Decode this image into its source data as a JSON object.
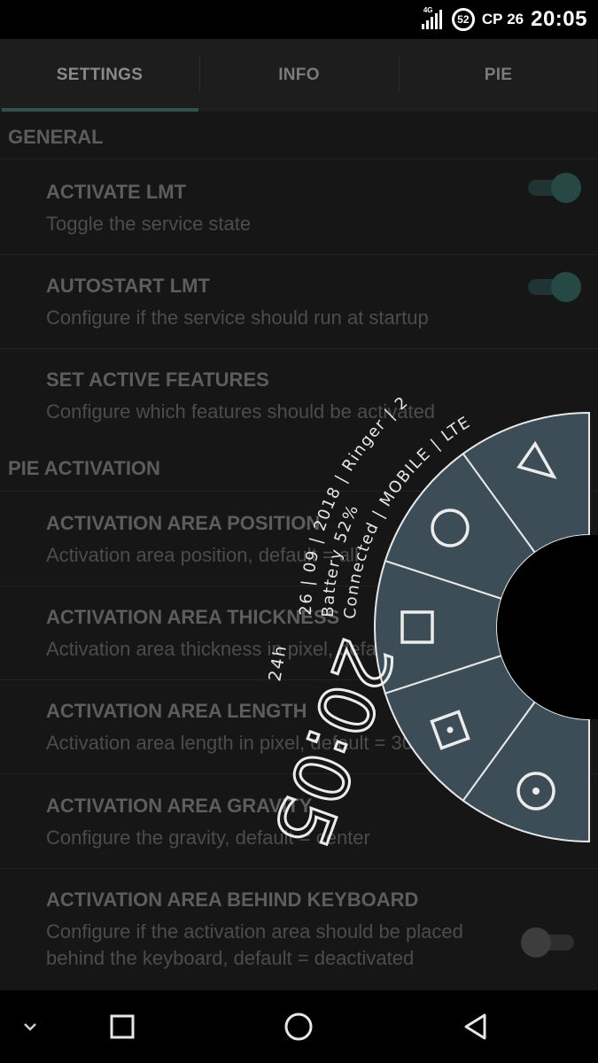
{
  "status_bar": {
    "network_type": "4G",
    "battery_level": "52",
    "date": "СР 26",
    "time": "20:05"
  },
  "tabs": [
    {
      "label": "SETTINGS",
      "active": true
    },
    {
      "label": "INFO",
      "active": false
    },
    {
      "label": "PIE",
      "active": false
    }
  ],
  "sections": {
    "general": "GENERAL",
    "pie_activation": "PIE ACTIVATION"
  },
  "preferences": [
    {
      "title": "ACTIVATE LMT",
      "summary": "Toggle the service state",
      "toggle": "on"
    },
    {
      "title": "AUTOSTART LMT",
      "summary": "Configure if the service should run at startup",
      "toggle": "on"
    },
    {
      "title": "SET ACTIVE FEATURES",
      "summary": "Configure which features should be activated"
    },
    {
      "title": "ACTIVATION AREA POSITION",
      "summary": "Activation area position, default = all"
    },
    {
      "title": "ACTIVATION AREA THICKNESS",
      "summary": "Activation area thickness in pixel, default = 30"
    },
    {
      "title": "ACTIVATION AREA LENGTH",
      "summary": "Activation area length in pixel, default = 300"
    },
    {
      "title": "ACTIVATION AREA GRAVITY",
      "summary": "Configure the gravity, default = center"
    },
    {
      "title": "ACTIVATION AREA BEHIND KEYBOARD",
      "summary": "Configure if the activation area should be placed behind the keyboard, default = deactivated",
      "toggle": "off"
    }
  ],
  "pie": {
    "clock": "20:05",
    "format": "24h",
    "info_line1": "26 | 09 | 2018 | Ringer | 2",
    "info_line2": "Battery 52% | Connected | MOBILE | LTE",
    "buttons": [
      "back",
      "home",
      "recents",
      "screenshot",
      "power"
    ],
    "colors": {
      "segment_fill": "#3d4d58",
      "segment_stroke": "#e8e8e8",
      "hole": "#000000"
    }
  },
  "nav_bar": {
    "buttons": [
      "hide-nav",
      "recents",
      "home",
      "back"
    ]
  },
  "colors": {
    "background": "#161616",
    "accent": "#33504d",
    "status_bar": "#000000"
  }
}
